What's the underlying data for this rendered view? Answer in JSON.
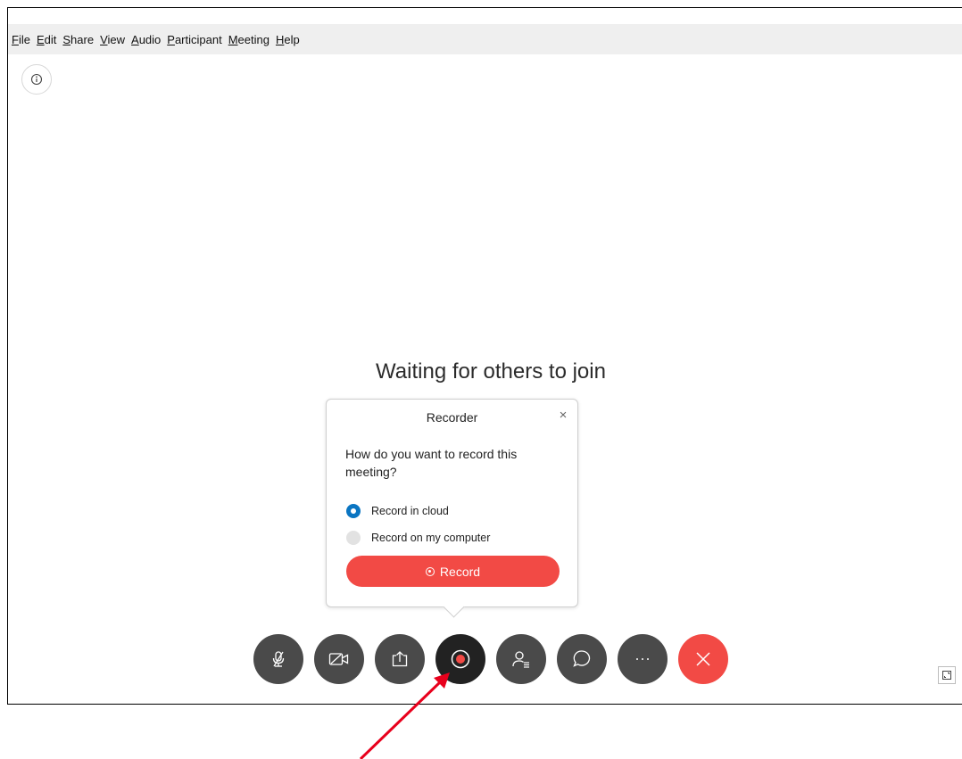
{
  "menubar": {
    "items": [
      {
        "accel": "F",
        "rest": "ile"
      },
      {
        "accel": "E",
        "rest": "dit"
      },
      {
        "accel": "S",
        "rest": "hare"
      },
      {
        "accel": "V",
        "rest": "iew"
      },
      {
        "accel": "A",
        "rest": "udio"
      },
      {
        "accel": "P",
        "rest": "articipant"
      },
      {
        "accel": "M",
        "rest": "eeting"
      },
      {
        "accel": "H",
        "rest": "elp"
      }
    ]
  },
  "main": {
    "status_text": "Waiting for others to join"
  },
  "recorder_popover": {
    "title": "Recorder",
    "close_glyph": "×",
    "question": "How do you want to record this meeting?",
    "options": [
      {
        "label": "Record in cloud",
        "selected": true
      },
      {
        "label": "Record on my computer",
        "selected": false
      }
    ],
    "record_button_label": "Record"
  },
  "toolbar": {
    "buttons": [
      {
        "name": "mute-button",
        "icon": "microphone-muted-icon"
      },
      {
        "name": "video-button",
        "icon": "video-off-icon"
      },
      {
        "name": "share-button",
        "icon": "share-icon"
      },
      {
        "name": "record-toolbar-button",
        "icon": "record-icon",
        "active": true
      },
      {
        "name": "participants-button",
        "icon": "participants-icon"
      },
      {
        "name": "chat-button",
        "icon": "chat-icon"
      },
      {
        "name": "more-button",
        "icon": "more-icon"
      },
      {
        "name": "leave-meeting-button",
        "icon": "close-icon"
      }
    ]
  },
  "colors": {
    "accent_red": "#f24a45",
    "radio_selected": "#0a75c2",
    "toolbar_button": "#4a4a4a",
    "annotation_arrow": "#e8001c"
  },
  "icons": {
    "info": "info-icon",
    "expand": "expand-icon"
  }
}
